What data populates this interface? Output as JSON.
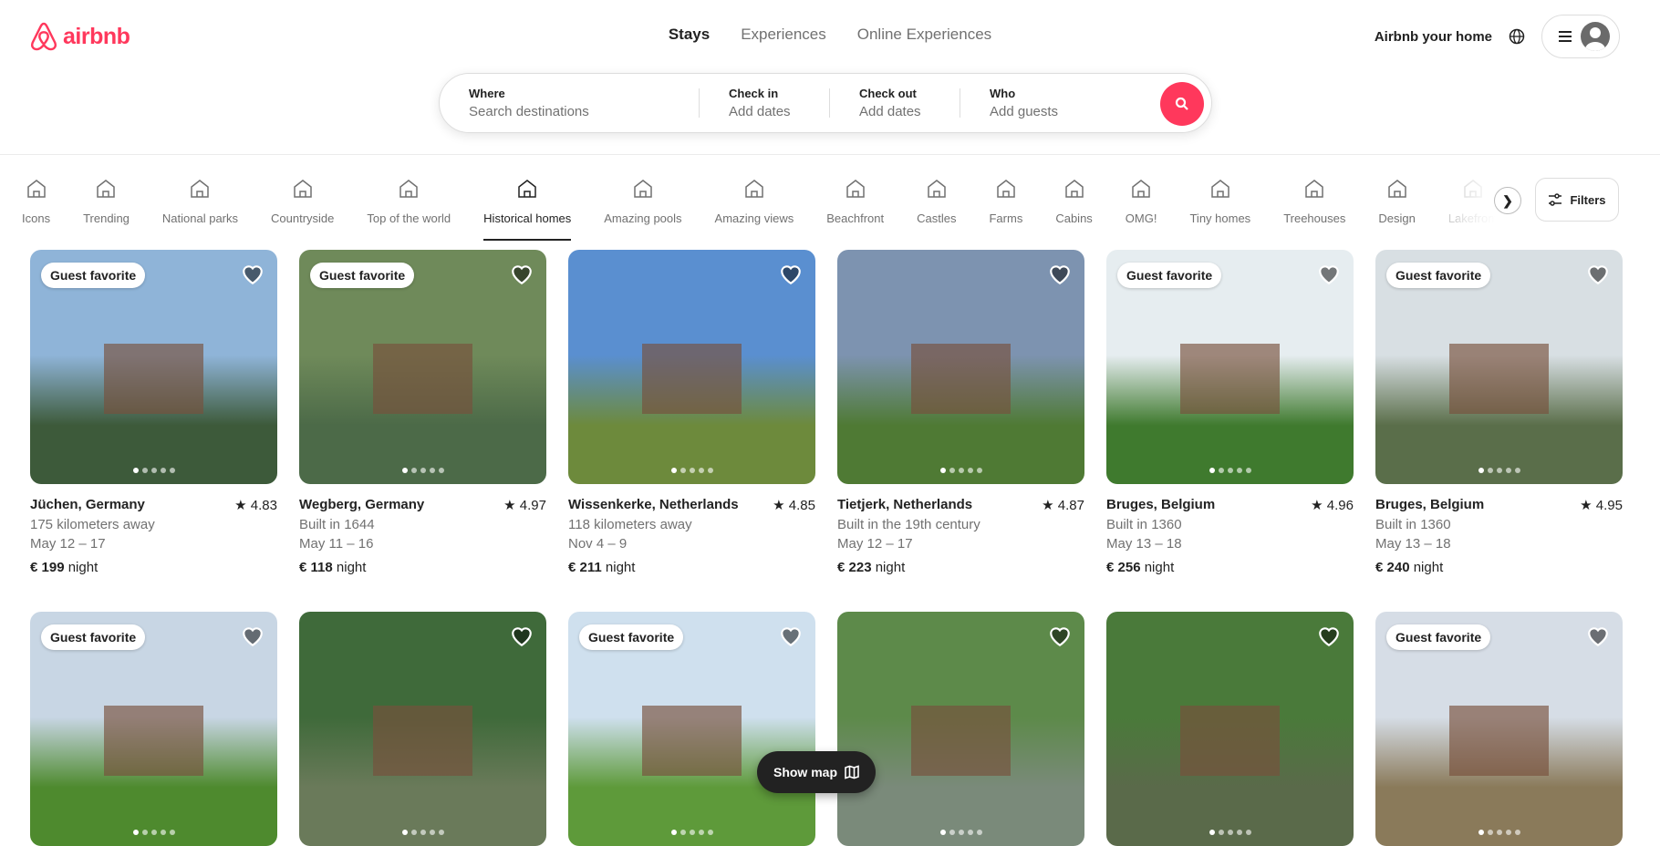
{
  "colors": {
    "brand": "#ff385c"
  },
  "header": {
    "logo": "airbnb",
    "nav": [
      "Stays",
      "Experiences",
      "Online Experiences"
    ],
    "host": "Airbnb your home",
    "icons": [
      "globe-icon",
      "menu-icon",
      "user-avatar"
    ]
  },
  "search": {
    "where": {
      "label": "Where",
      "placeholder": "Search destinations"
    },
    "checkin": {
      "label": "Check in",
      "placeholder": "Add dates"
    },
    "checkout": {
      "label": "Check out",
      "placeholder": "Add dates"
    },
    "who": {
      "label": "Who",
      "placeholder": "Add guests"
    }
  },
  "categories": [
    {
      "label": "Icons"
    },
    {
      "label": "Trending"
    },
    {
      "label": "National parks"
    },
    {
      "label": "Countryside"
    },
    {
      "label": "Top of the world"
    },
    {
      "label": "Historical homes",
      "active": true
    },
    {
      "label": "Amazing pools"
    },
    {
      "label": "Amazing views"
    },
    {
      "label": "Beachfront"
    },
    {
      "label": "Castles"
    },
    {
      "label": "Farms"
    },
    {
      "label": "Cabins"
    },
    {
      "label": "OMG!"
    },
    {
      "label": "Tiny homes"
    },
    {
      "label": "Treehouses"
    },
    {
      "label": "Design"
    },
    {
      "label": "Lakefront"
    }
  ],
  "filters_label": "Filters",
  "badge_text": "Guest favorite",
  "listings": [
    {
      "title": "Jüchen, Germany",
      "rating": "4.83",
      "sub": "175 kilometers away",
      "dates": "May 12 – 17",
      "price": "€ 199",
      "unit": "night",
      "fav": true,
      "sky": "#8fb4d8",
      "ground": "#3d5a3a"
    },
    {
      "title": "Wegberg, Germany",
      "rating": "4.97",
      "sub": "Built in 1644",
      "dates": "May 11 – 16",
      "price": "€ 118",
      "unit": "night",
      "fav": true,
      "sky": "#6f8a5a",
      "ground": "#4c6a48"
    },
    {
      "title": "Wissenkerke, Netherlands",
      "rating": "4.85",
      "sub": "118 kilometers away",
      "dates": "Nov 4 – 9",
      "price": "€ 211",
      "unit": "night",
      "fav": false,
      "sky": "#5a8fd0",
      "ground": "#6d8a3c"
    },
    {
      "title": "Tietjerk, Netherlands",
      "rating": "4.87",
      "sub": "Built in the 19th century",
      "dates": "May 12 – 17",
      "price": "€ 223",
      "unit": "night",
      "fav": false,
      "sky": "#7d93b0",
      "ground": "#4f7a34"
    },
    {
      "title": "Bruges, Belgium",
      "rating": "4.96",
      "sub": "Built in 1360",
      "dates": "May 13 – 18",
      "price": "€ 256",
      "unit": "night",
      "fav": true,
      "sky": "#e6edf0",
      "ground": "#3f7a2e"
    },
    {
      "title": "Bruges, Belgium",
      "rating": "4.95",
      "sub": "Built in 1360",
      "dates": "May 13 – 18",
      "price": "€ 240",
      "unit": "night",
      "fav": true,
      "sky": "#d8dfe3",
      "ground": "#5a6e4a"
    },
    {
      "fav": true,
      "sky": "#c8d6e4",
      "ground": "#4e8a2e"
    },
    {
      "fav": false,
      "sky": "#3f6a3a",
      "ground": "#6a7a5a"
    },
    {
      "fav": true,
      "sky": "#cfe0ee",
      "ground": "#5e9a3a"
    },
    {
      "fav": false,
      "sky": "#5d8a4a",
      "ground": "#7a8a7a"
    },
    {
      "fav": false,
      "sky": "#4a7a3a",
      "ground": "#5a6a4a"
    },
    {
      "fav": true,
      "sky": "#d6dde6",
      "ground": "#8a7a5a"
    }
  ],
  "show_map_label": "Show map"
}
